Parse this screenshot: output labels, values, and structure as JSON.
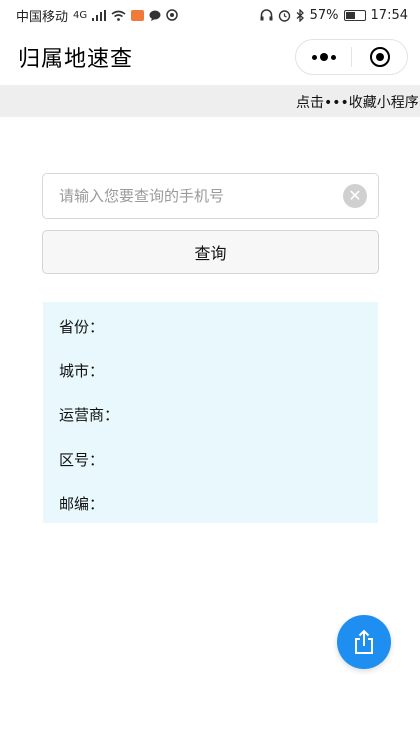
{
  "status_bar": {
    "carrier": "中国移动",
    "network": "4G",
    "battery": "57%",
    "time": "17:54"
  },
  "nav": {
    "title": "归属地速查"
  },
  "banner": {
    "text": "点击•••收藏小程序"
  },
  "search": {
    "placeholder": "请输入您要查询的手机号",
    "value": ""
  },
  "query_button": {
    "label": "查询"
  },
  "result": {
    "province_label": "省份：",
    "city_label": "城市：",
    "carrier_label": "运营商：",
    "area_code_label": "区号：",
    "postcode_label": "邮编："
  },
  "colors": {
    "accent": "#1e8ff0",
    "result_bg": "#e9f8fc",
    "banner_bg": "#eeeeee"
  }
}
